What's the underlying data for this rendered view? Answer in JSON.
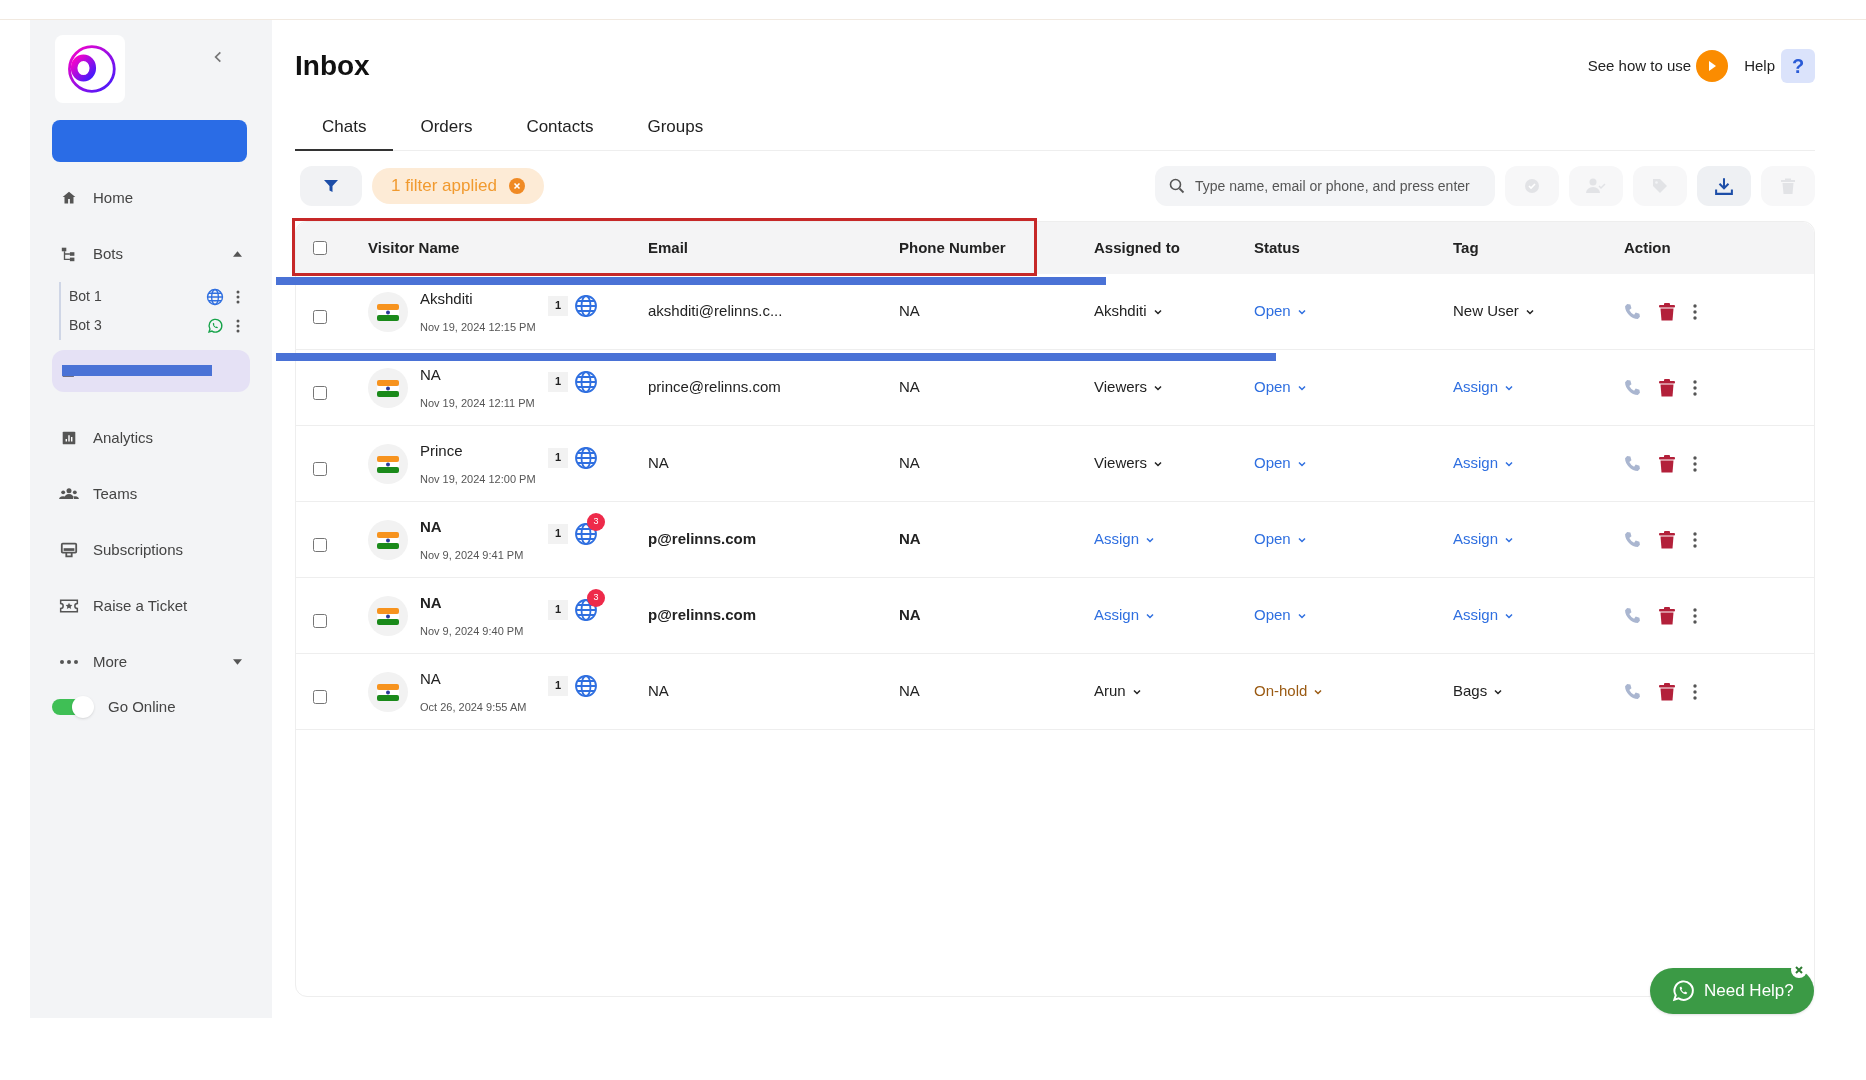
{
  "sidebar": {
    "button": {
      "kind": "redacted"
    },
    "items": [
      {
        "label": "Home",
        "selected": false
      },
      {
        "label": "Bots",
        "selected": false,
        "expanded": true,
        "children": [
          {
            "label": "Bot 1",
            "kind": "web"
          },
          {
            "label": "Bot 3",
            "kind": "whatsapp"
          }
        ]
      },
      {
        "kind": "redacted",
        "selected": true
      },
      {
        "label": "Analytics",
        "selected": false
      },
      {
        "label": "Teams",
        "selected": false
      },
      {
        "label": "Subscriptions",
        "selected": false
      },
      {
        "label": "Raise a Ticket",
        "selected": false
      },
      {
        "label": "More",
        "selected": false,
        "expanded": false
      }
    ],
    "go_online": {
      "label": "Go Online",
      "on": true
    }
  },
  "header": {
    "title": "Inbox",
    "how_to": "See how to use",
    "help": "Help",
    "help_icon": "?"
  },
  "tabs": [
    {
      "label": "Chats",
      "selected": true
    },
    {
      "label": "Orders",
      "selected": false
    },
    {
      "label": "Contacts",
      "selected": false
    },
    {
      "label": "Groups",
      "selected": false
    }
  ],
  "toolbar": {
    "filter_chip": "1 filter applied",
    "search": {
      "placeholder": "Type name, email or phone, and press enter"
    },
    "actions": [
      {
        "kind": "resolve",
        "disabled": true
      },
      {
        "kind": "assign",
        "disabled": true
      },
      {
        "kind": "tag",
        "disabled": true
      },
      {
        "kind": "download",
        "disabled": false
      },
      {
        "kind": "delete",
        "disabled": true
      }
    ]
  },
  "table": {
    "all_checked": false,
    "columns": [
      "Visitor Name",
      "Email",
      "Phone Number",
      "Assigned to",
      "Status",
      "Tag",
      "Action"
    ],
    "rows": [
      {
        "name": "Akshditi",
        "time": "Nov 19, 2024 12:15 PM",
        "count": "1",
        "unread": null,
        "email": "akshditi@relinns.c...",
        "phone": "NA",
        "assigned": {
          "label": "Akshditi",
          "set": true
        },
        "status": {
          "label": "Open",
          "kind": "open"
        },
        "tag": {
          "label": "New User",
          "set": true
        },
        "bold": false,
        "checked": false,
        "redacted": true
      },
      {
        "name": "NA",
        "time": "Nov 19, 2024 12:11 PM",
        "count": "1",
        "unread": null,
        "email": "prince@relinns.com",
        "phone": "NA",
        "assigned": {
          "label": "Viewers",
          "set": true
        },
        "status": {
          "label": "Open",
          "kind": "open"
        },
        "tag": {
          "label": "Assign",
          "set": false
        },
        "bold": false,
        "checked": false,
        "redacted": true
      },
      {
        "name": "Prince",
        "time": "Nov 19, 2024 12:00 PM",
        "count": "1",
        "unread": null,
        "email": "NA",
        "phone": "NA",
        "assigned": {
          "label": "Viewers",
          "set": true
        },
        "status": {
          "label": "Open",
          "kind": "open"
        },
        "tag": {
          "label": "Assign",
          "set": false
        },
        "bold": false,
        "checked": false,
        "redacted": false
      },
      {
        "name": "NA",
        "time": "Nov 9, 2024 9:41 PM",
        "count": "1",
        "unread": "3",
        "email": "p@relinns.com",
        "phone": "NA",
        "assigned": {
          "label": "Assign",
          "set": false
        },
        "status": {
          "label": "Open",
          "kind": "open"
        },
        "tag": {
          "label": "Assign",
          "set": false
        },
        "bold": true,
        "checked": false,
        "redacted": false
      },
      {
        "name": "NA",
        "time": "Nov 9, 2024 9:40 PM",
        "count": "1",
        "unread": "3",
        "email": "p@relinns.com",
        "phone": "NA",
        "assigned": {
          "label": "Assign",
          "set": false
        },
        "status": {
          "label": "Open",
          "kind": "open"
        },
        "tag": {
          "label": "Assign",
          "set": false
        },
        "bold": true,
        "checked": false,
        "redacted": false
      },
      {
        "name": "NA",
        "time": "Oct 26, 2024 9:55 AM",
        "count": "1",
        "unread": null,
        "email": "NA",
        "phone": "NA",
        "assigned": {
          "label": "Arun",
          "set": true
        },
        "status": {
          "label": "On-hold",
          "kind": "on_hold"
        },
        "tag": {
          "label": "Bags",
          "set": true
        },
        "bold": false,
        "checked": false,
        "redacted": false
      }
    ]
  },
  "help_widget": {
    "label": "Need Help?"
  }
}
